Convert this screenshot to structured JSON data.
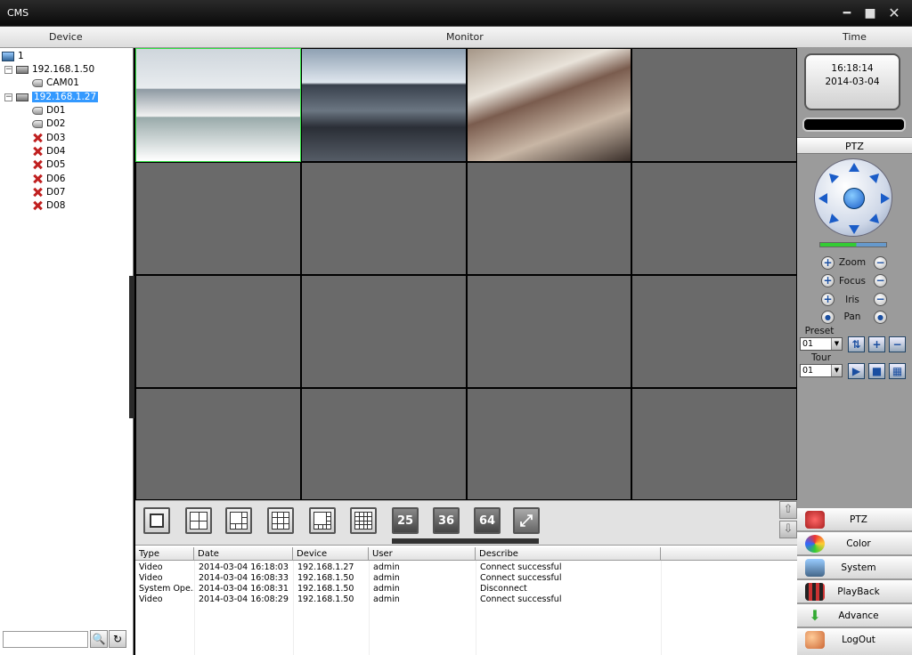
{
  "window": {
    "title": "CMS"
  },
  "header": {
    "device": "Device",
    "monitor": "Monitor",
    "time": "Time"
  },
  "tree": {
    "root": "1",
    "hosts": [
      {
        "label": "192.168.1.50",
        "children": [
          "CAM01"
        ]
      },
      {
        "label": "192.168.1.27",
        "children": [
          "D01",
          "D02",
          "D03",
          "D04",
          "D05",
          "D06",
          "D07",
          "D08"
        ]
      }
    ]
  },
  "search": {
    "value": ""
  },
  "clock": {
    "time": "16:18:14",
    "date": "2014-03-04"
  },
  "ptz": {
    "title": "PTZ",
    "zoom": "Zoom",
    "focus": "Focus",
    "iris": "Iris",
    "pan": "Pan",
    "preset_label": "Preset",
    "preset_value": "01",
    "tour_label": "Tour",
    "tour_value": "01"
  },
  "layouts": [
    "25",
    "36",
    "64"
  ],
  "log": {
    "columns": [
      "Type",
      "Date",
      "Device",
      "User",
      "Describe"
    ],
    "rows": [
      [
        "Video",
        "2014-03-04 16:18:03",
        "192.168.1.27",
        "admin",
        "Connect successful"
      ],
      [
        "Video",
        "2014-03-04 16:08:33",
        "192.168.1.50",
        "admin",
        "Connect successful"
      ],
      [
        "System Ope...",
        "2014-03-04 16:08:31",
        "192.168.1.50",
        "admin",
        "Disconnect"
      ],
      [
        "Video",
        "2014-03-04 16:08:29",
        "192.168.1.50",
        "admin",
        "Connect successful"
      ]
    ]
  },
  "menu": [
    "PTZ",
    "Color",
    "System",
    "PlayBack",
    "Advance",
    "LogOut"
  ]
}
